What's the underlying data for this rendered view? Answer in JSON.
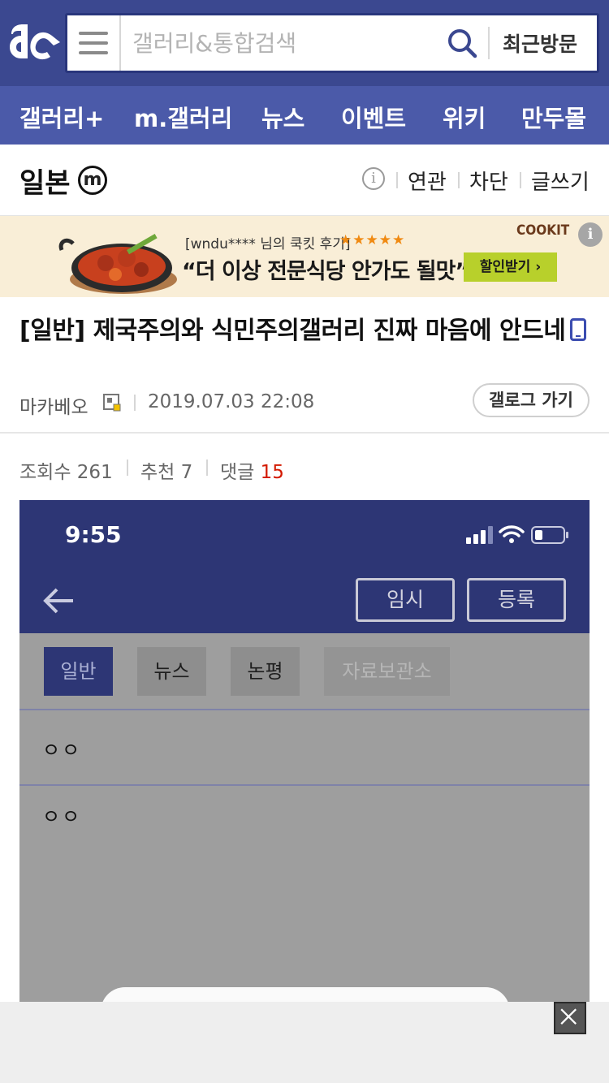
{
  "header": {
    "search_placeholder": "갤러리&통합검색",
    "recent_label": "최근방문"
  },
  "nav": {
    "items": [
      "갤러리+",
      "m.갤러리",
      "뉴스",
      "이벤트",
      "위키",
      "만두몰"
    ]
  },
  "gallery": {
    "name": "일본",
    "badge": "m",
    "links": [
      "연관",
      "차단",
      "글쓰기"
    ]
  },
  "ad": {
    "reviewer": "[wndu**** 님의 쿡킷 후기]",
    "stars": "★★★★★",
    "headline": "“더 이상 전문식당 안가도 될맛”",
    "brand": "COOKIT",
    "cta": "할인받기 ›"
  },
  "post": {
    "title": "[일반] 제국주의와 식민주의갤러리 진짜 마음에 안드네",
    "author": "마카베오",
    "date": "2019.07.03 22:08",
    "galog_label": "갤로그 가기",
    "views_label": "조회수",
    "views": "261",
    "recommend_label": "추천",
    "recommend": "7",
    "comments_label": "댓글",
    "comments": "15"
  },
  "embedded_screenshot": {
    "time": "9:55",
    "temp_button": "임시",
    "submit_button": "등록",
    "tabs": [
      "일반",
      "뉴스",
      "논평",
      "자료보관소"
    ],
    "row1": "ㅇㅇ",
    "row2": "ㅇㅇ"
  },
  "colors": {
    "header_bg": "#3b4890",
    "nav_bg": "#4b5aa9",
    "comment_count": "#d31900",
    "ad_cta": "#b8d02b"
  }
}
